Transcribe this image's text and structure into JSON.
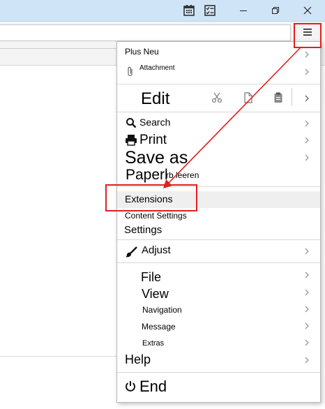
{
  "titlebar": {
    "icons": [
      "calendar-icon",
      "checklist-icon"
    ],
    "buttons": [
      "minimize-icon",
      "restore-icon",
      "close-icon"
    ]
  },
  "toolbar": {
    "menu_icon": "hamburger-menu-icon"
  },
  "menu": {
    "plus_neu": "Plus Neu",
    "attachment": "Attachment",
    "edit": "Edit",
    "edit_icons": [
      "scissors-icon",
      "copy-icon",
      "paste-icon"
    ],
    "search": "Search",
    "print": "Print",
    "save_as": "Save as",
    "paperkorb": "Paperl",
    "paperkorb_suffix": "rb leeren",
    "extensions": "Extensions",
    "content_settings": "Content Settings",
    "settings": "Settings",
    "adjust": "Adjust",
    "file": "File",
    "view": "View",
    "navigation": "Navigation",
    "message": "Message",
    "extras": "Extras",
    "help": "Help",
    "end": "End"
  },
  "colors": {
    "titlebar": "#cfe4f6",
    "annotation": "#e0201c",
    "highlight": "#efefef"
  }
}
